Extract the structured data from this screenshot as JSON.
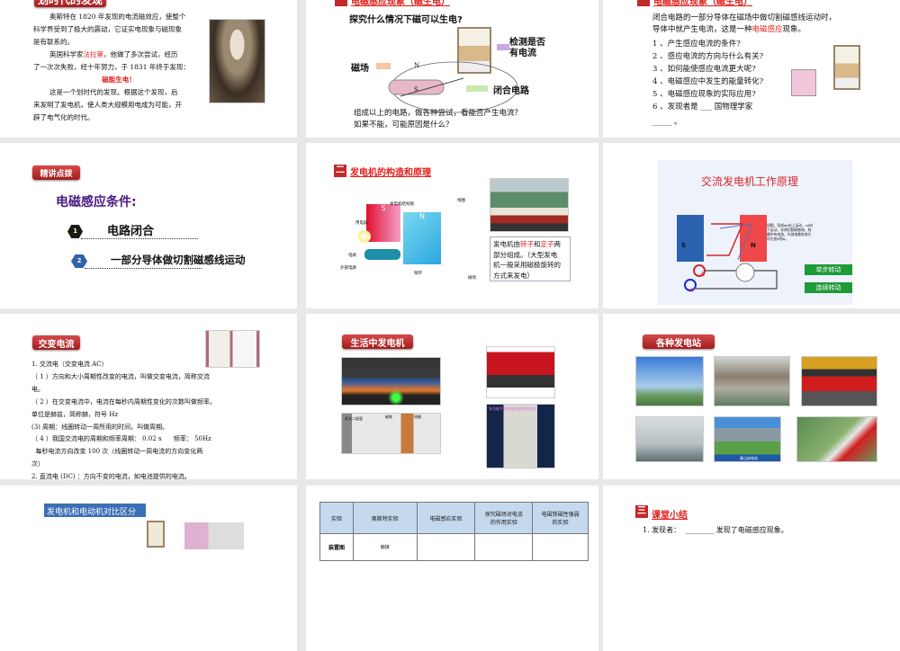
{
  "slides": [
    {
      "title": "划时代的发现",
      "lines": [
        "奥斯特在 1820 年发现的电流磁效应，使整个",
        "科学界受到了极大的震动，它证实电现象与磁现象",
        "是有联系的。"
      ],
      "line2a": "英国科学家",
      "faraday": "法拉第",
      "line2b": "，他做了多次尝试，经历",
      "line3": "了一次次失败，经十年努力，于 1831 年终于发现：",
      "highlight": "磁能生电！",
      "lines2": [
        "这是一个划时代的发现。根据这个发现，后",
        "来发明了发电机，使人类大规模用电成为可能，开",
        "辟了电气化的时代。"
      ]
    },
    {
      "title": "电磁感应现象（磁生电）",
      "heading": "探究什么情况下磁可以生电?",
      "label_detect": "检测是否",
      "label_detect2": "有电流",
      "label_field": "磁场",
      "label_circuit": "闭合电路",
      "pole_n": "N",
      "pole_s": "S",
      "q1": "组成以上的电路，做各种尝试，看能否产生电流？",
      "q2": "如果不能，可能原因是什么？"
    },
    {
      "title": "电磁感应现象（磁生电）",
      "p1": "闭合电路的一部分导体在磁场中做切割磁感线运动时，",
      "p2a": "导体中就产生电流，这是一种",
      "p2red": "电磁感应",
      "p2b": "现象。",
      "items": [
        "1 、产生感应电流的条件?",
        "2 、感应电流的方向与什么有关?",
        "3 、如何能使感应电流更大呢?",
        "4 、电磁感应中发生的能量转化?",
        "5 、电磁感应现象的实际应用?",
        "6 、发现者是 ___ 国物理学家"
      ],
      "blank": "_____ 。"
    },
    {
      "badge": "精讲点拨",
      "heading": "电磁感应条件:",
      "items": [
        {
          "num": "1",
          "text": "电路闭合"
        },
        {
          "num": "2",
          "text": "一部分导体做切割磁感线运动"
        }
      ]
    },
    {
      "sec_num": "二",
      "title": "发电机的构造和原理",
      "diagram_labels": {
        "title": "发电机结构图",
        "coil": "线圈",
        "load": "用电器",
        "brush": "电刷",
        "external": "外部电路",
        "ring": "铜环",
        "magnet": "磁场",
        "s": "S",
        "n": "N"
      },
      "box_a": "发电机由",
      "rotor": "转子",
      "box_b": "和",
      "stator": "定子",
      "box_c": "两",
      "box_lines": [
        "部分组成。（大型发电",
        "机一般采用磁极旋转的",
        "方式来发电）"
      ]
    },
    {
      "title": "交流发电机工作原理",
      "desc": [
        "如图，导线ab向上运动，cd向",
        "下运动，导线切割磁感线，线",
        "圈中有电流，外部电路电流方",
        "向为由B到A。"
      ],
      "s": "S",
      "n": "N",
      "a": "A",
      "b": "B",
      "btn_step": "单步转动",
      "btn_cont": "连续转动"
    },
    {
      "badge": "交变电流",
      "lines": [
        "1. 交流电（交变电流 AC）",
        "（ 1 ）方向和大小周期性改变的电流，叫做交变电流，简称交流",
        "电。",
        "（ 2 ）在交变电流中，电流在每秒内周期性变化的次数叫做频率。",
        "单位是赫兹，简称赫，符号 Hz",
        " (3) 周期：线圈转动一周所用的时间，叫做周期。",
        "（ 4 ）我国交流电的周期和频率周期： 0.02 s      频率： 50Hz",
        "  每秒电流方向改变 100 次（线圈转动一周电流的方向变化两",
        "次）",
        "2. 直流电 (DC) ：方向不变的电流，如电池提供的电流。"
      ]
    },
    {
      "badge": "生活中发电机",
      "flash_labels": [
        "发光二极管",
        "磁铁",
        "线圈"
      ],
      "poster_title": "多功能手摇发电应急照明电源"
    },
    {
      "badge": "各种发电站",
      "nuclear_caption": "秦山核电站"
    },
    {
      "label": "发电机和电动机对比区分"
    },
    {
      "headers": [
        "实验",
        "奥斯特实验",
        "电磁感应实验",
        "探究磁场对电流的作用实验",
        "电磁铁磁性强弱的实验"
      ],
      "row_label": "装置图",
      "cell_label": "触接"
    },
    {
      "sec_num": "三",
      "title": "课堂小结",
      "line": "1. 发现者：  ________ 发现了电磁感应现象。"
    }
  ],
  "colors": {
    "accent_red": "#e0201c",
    "purple": "#4b1a7f",
    "blue_label": "#3b6fb5",
    "green_btn": "#1e9a38"
  }
}
